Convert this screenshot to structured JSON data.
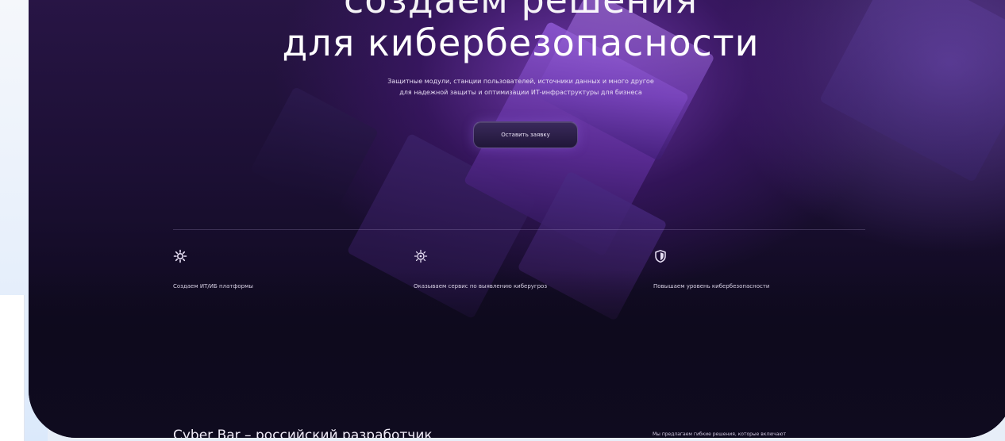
{
  "hero": {
    "title_line1": "создаем решения",
    "title_line2": "для кибербезопасности",
    "subtitle_line1": "Защитные модули, станции пользователей, источники данных и много другое",
    "subtitle_line2": "для надежной защиты и оптимизации ИТ-инфраструктуры для бизнеса",
    "cta_label": "Оставить заявку"
  },
  "features": [
    {
      "icon": "gear-network-icon",
      "label": "Создаем ИТ/ИБ платформы"
    },
    {
      "icon": "radar-scan-icon",
      "label": "Оказываем сервис по выявлению киберугроз"
    },
    {
      "icon": "shield-icon",
      "label": "Повышаем уровень кибербезопасности"
    }
  ],
  "about": {
    "title": "Cyber Bar – российский разработчик",
    "text": "Мы предлагаем гибкие решения, которые включают"
  },
  "colors": {
    "hero_top": "#2a1648",
    "hero_bottom": "#0e0a1d",
    "accent_purple": "#8d57d2",
    "text_light": "#ffffff"
  }
}
